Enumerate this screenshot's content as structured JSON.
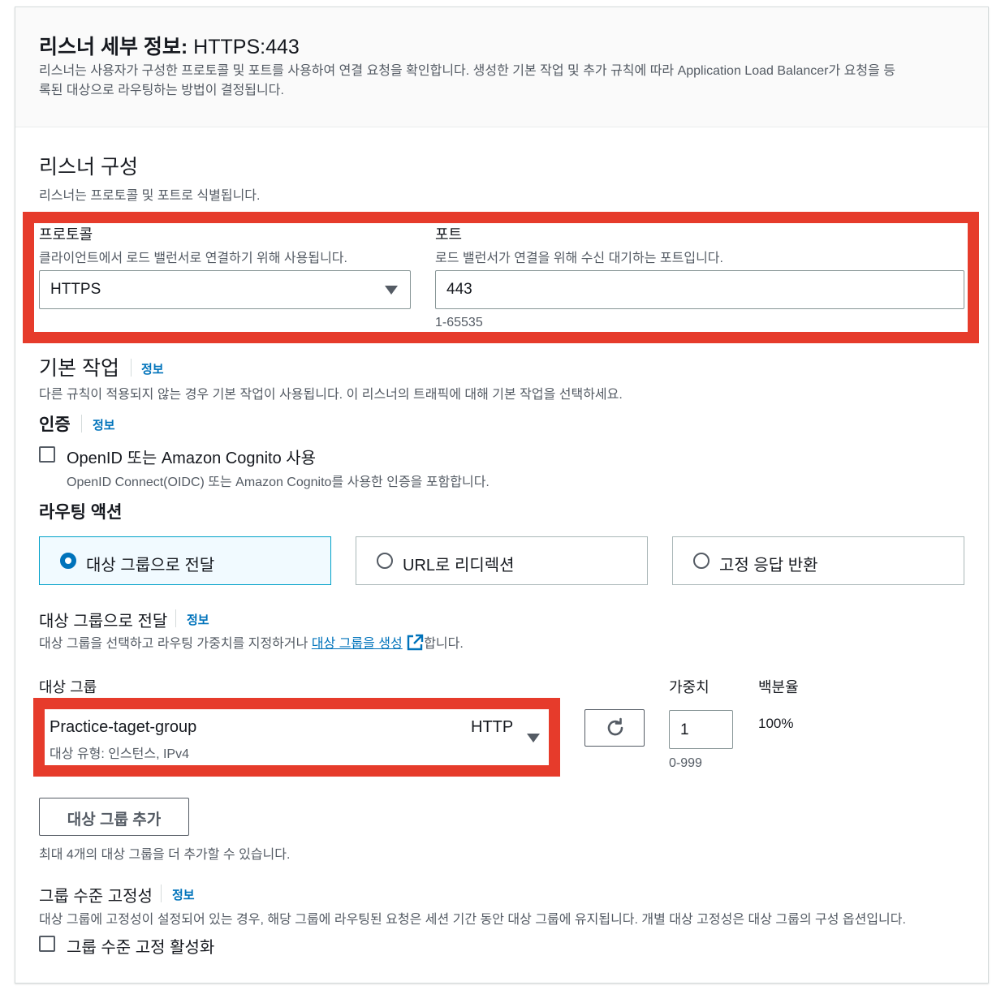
{
  "header": {
    "title_bold": "리스너 세부 정보:",
    "title_value": "HTTPS:443",
    "description_line1": "리스너는 사용자가 구성한 프로토콜 및 포트를 사용하여 연결 요청을 확인합니다. 생성한 기본 작업 및 추가 규칙에 따라 Application Load Balancer가 요청을 등",
    "description_line2": "록된 대상으로 라우팅하는 방법이 결정됩니다."
  },
  "listener_config": {
    "title": "리스너 구성",
    "description": "리스너는 프로토콜 및 포트로 식별됩니다.",
    "protocol": {
      "label": "프로토콜",
      "description": "클라이언트에서 로드 밸런서로 연결하기 위해 사용됩니다.",
      "value": "HTTPS"
    },
    "port": {
      "label": "포트",
      "description": "로드 밸런서가 연결을 위해 수신 대기하는 포트입니다.",
      "value": "443",
      "hint": "1-65535"
    }
  },
  "default_action": {
    "title": "기본 작업",
    "info": "정보",
    "description": "다른 규칙이 적용되지 않는 경우 기본 작업이 사용됩니다. 이 리스너의 트래픽에 대해 기본 작업을 선택하세요."
  },
  "auth": {
    "title": "인증",
    "info": "정보",
    "checkbox_label": "OpenID 또는 Amazon Cognito 사용",
    "checkbox_description": "OpenID Connect(OIDC) 또는 Amazon Cognito를 사용한 인증을 포함합니다.",
    "checked": false
  },
  "routing": {
    "title": "라우팅 액션",
    "options": [
      {
        "label": "대상 그룹으로 전달",
        "selected": true
      },
      {
        "label": "URL로 리디렉션",
        "selected": false
      },
      {
        "label": "고정 응답 반환",
        "selected": false
      }
    ]
  },
  "forward": {
    "title": "대상 그룹으로 전달",
    "info": "정보",
    "description_prefix": "대상 그룹을 선택하고 라우팅 가중치를 지정하거나",
    "description_link": "대상 그룹을 생성",
    "description_suffix": "합니다.",
    "target_group_label": "대상 그룹",
    "weight_label": "가중치",
    "percent_label": "백분율",
    "target_group": {
      "name": "Practice-taget-group",
      "protocol": "HTTP",
      "meta": "대상 유형: 인스턴스, IPv4"
    },
    "weight_value": "1",
    "weight_hint": "0-999",
    "percent_value": "100%",
    "add_button": "대상 그룹 추가",
    "add_hint": "최대 4개의 대상 그룹을 더 추가할 수 있습니다."
  },
  "stickiness": {
    "title": "그룹 수준 고정성",
    "info": "정보",
    "description": "대상 그룹에 고정성이 설정되어 있는 경우, 해당 그룹에 라우팅된 요청은 세션 기간 동안 대상 그룹에 유지됩니다. 개별 대상 고정성은 대상 그룹의 구성 옵션입니다.",
    "checkbox_label": "그룹 수준 고정 활성화",
    "checked": false
  },
  "colors": {
    "highlight": "#e63b2b",
    "link": "#0073bb",
    "selected_tile_bg": "#f1faff"
  }
}
